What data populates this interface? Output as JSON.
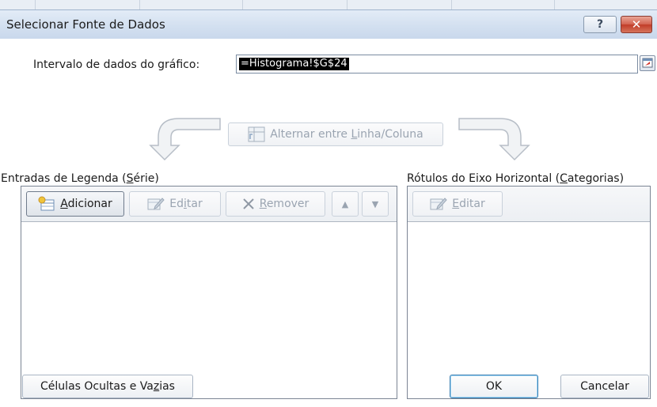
{
  "dialog": {
    "title": "Selecionar Fonte de Dados",
    "help_glyph": "?",
    "close_glyph": "✕"
  },
  "range": {
    "label": "Intervalo de dados do gráfico:",
    "value": "=Histograma!$G$24"
  },
  "switch_button": {
    "label_pre": "Alternar entre ",
    "label_u": "L",
    "label_post": "inha/Coluna"
  },
  "legend": {
    "label_pre": "Entradas de Legenda (",
    "label_u": "S",
    "label_post": "érie)",
    "add_u": "A",
    "add_rest": "dicionar",
    "edit_pre": "Ed",
    "edit_u": "i",
    "edit_post": "tar",
    "remove_u": "R",
    "remove_rest": "emover",
    "up_glyph": "▲",
    "down_glyph": "▼"
  },
  "categories": {
    "label_pre": "Rótulos do Eixo Horizontal (",
    "label_u": "C",
    "label_post": "ategorias)",
    "edit_u": "E",
    "edit_rest": "ditar"
  },
  "footer": {
    "hidden_pre": "Células Ocultas e Va",
    "hidden_u": "z",
    "hidden_post": "ias",
    "ok_label": "OK",
    "cancel_label": "Cancelar"
  },
  "icons": {
    "switch": "switch-rows-columns-icon",
    "add": "add-series-icon",
    "edit": "edit-pencil-icon",
    "remove": "remove-x-icon",
    "collapse": "collapse-dialog-icon"
  }
}
